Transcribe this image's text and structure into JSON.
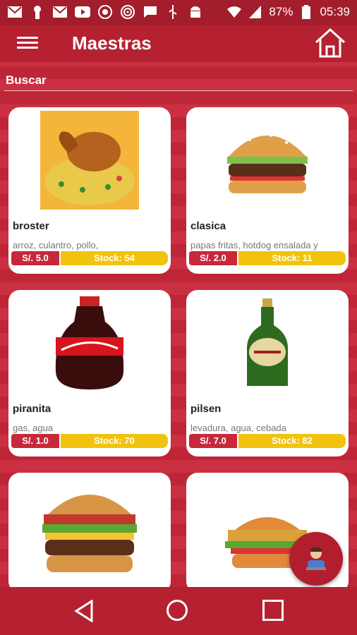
{
  "status_bar": {
    "battery": "87%",
    "time": "05:39",
    "icons": [
      "gmail-icon",
      "keyhole-icon",
      "gmail-icon",
      "youtube-icon",
      "chrome-icon",
      "target-icon",
      "message-icon",
      "usb-icon",
      "android-icon",
      "wifi-icon",
      "signal-icon",
      "battery-icon"
    ]
  },
  "app_bar": {
    "title": "Maestras",
    "menu_icon": "menu-icon",
    "home_icon": "home-icon"
  },
  "search": {
    "label": "Buscar"
  },
  "products": [
    {
      "name": "broster",
      "desc": "arroz, culantro, pollo,",
      "price": "S/. 5.0",
      "stock": "Stock: 54",
      "image": "roast-chicken-rice"
    },
    {
      "name": "clasica",
      "desc": "papas fritas, hotdog ensalada y",
      "price": "S/. 2.0",
      "stock": "Stock: 11",
      "image": "hamburger"
    },
    {
      "name": "piranita",
      "desc": "gas, agua",
      "price": "S/. 1.0",
      "stock": "Stock: 70",
      "image": "coca-cola-bottle"
    },
    {
      "name": "pilsen",
      "desc": "levadura, agua, cebada",
      "price": "S/. 7.0",
      "stock": "Stock: 82",
      "image": "beer-bottle"
    },
    {
      "image": "bacon-burger"
    },
    {
      "image": "chicken-burger"
    }
  ],
  "colors": {
    "primary": "#b52131",
    "price": "#c8283a",
    "stock": "#f2c30e"
  }
}
